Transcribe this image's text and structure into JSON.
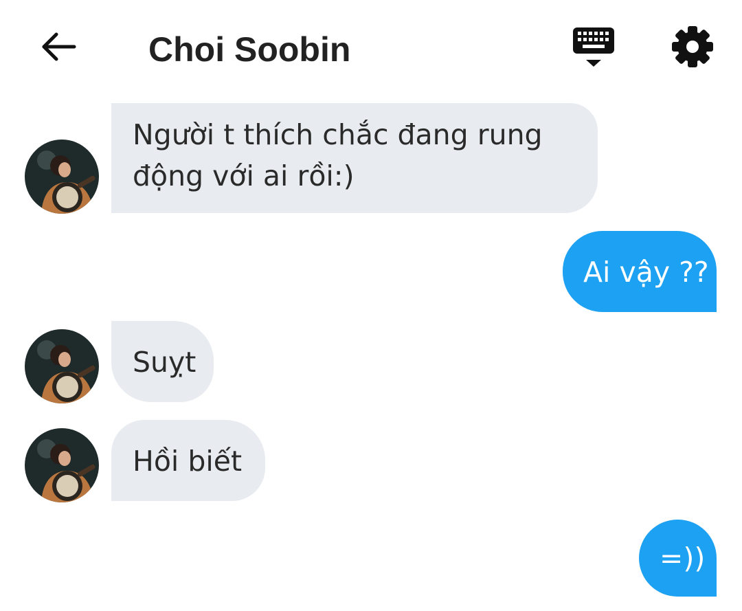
{
  "header": {
    "title": "Choi Soobin",
    "back_icon": "arrow-left-icon",
    "keyboard_icon": "keyboard-hide-icon",
    "settings_icon": "gear-icon"
  },
  "colors": {
    "incoming_bubble": "#e8ecf0",
    "outgoing_bubble": "#1da1f2",
    "icon": "#111111"
  },
  "messages": [
    {
      "side": "incoming",
      "text": "Người t thích chắc đang rung\nđộng với ai rồi:)"
    },
    {
      "side": "outgoing",
      "text": "Ai vậy ??"
    },
    {
      "side": "incoming",
      "text": "Suỵt"
    },
    {
      "side": "incoming",
      "text": "Hồi biết"
    },
    {
      "side": "outgoing",
      "text": "=))"
    }
  ]
}
